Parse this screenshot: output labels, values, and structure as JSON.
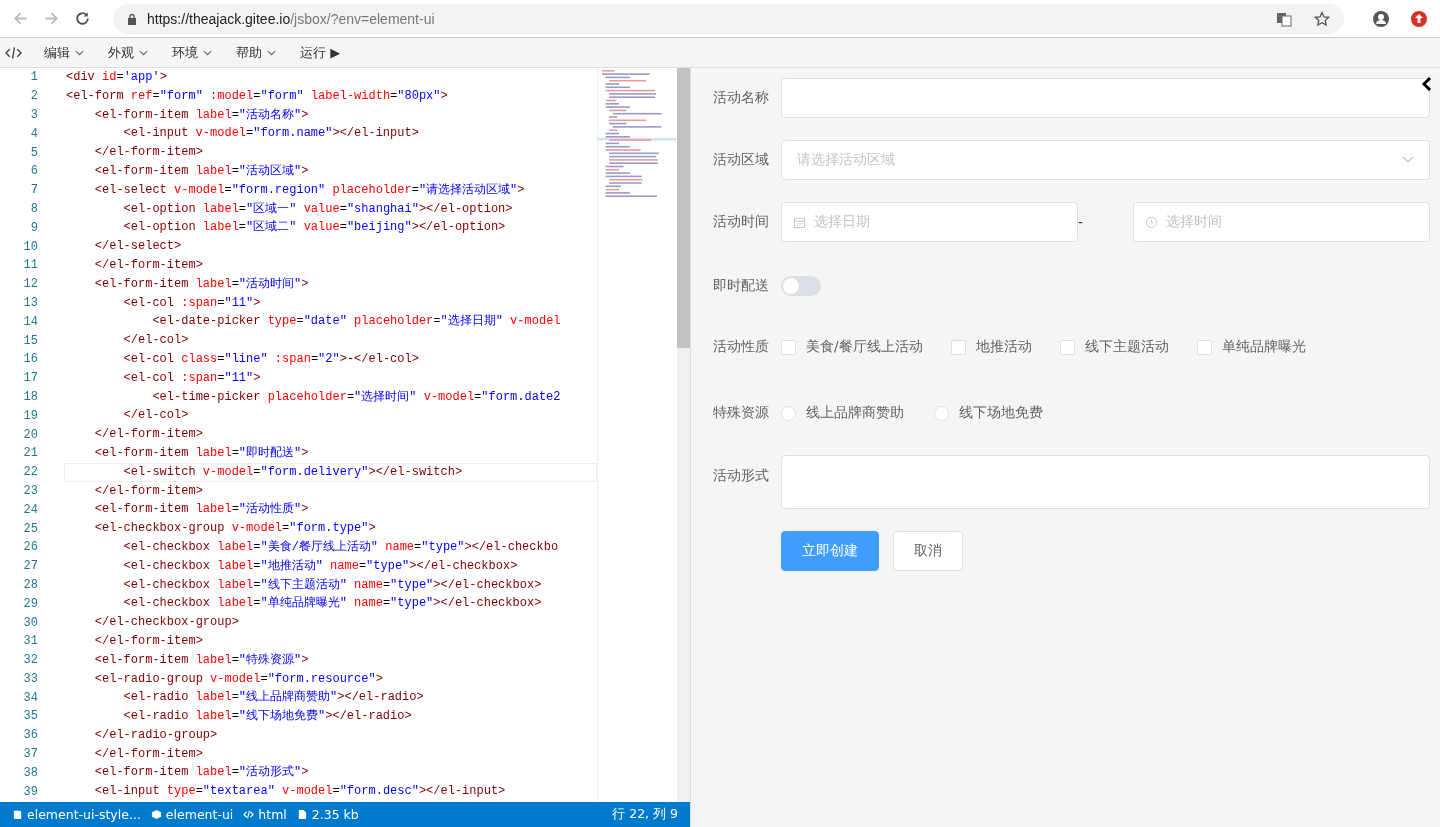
{
  "browser": {
    "url_scheme_host": "https://theajack.gitee.io",
    "url_path": "/jsbox/?env=element-ui"
  },
  "menu": [
    {
      "label": "编辑",
      "kind": "dropdown"
    },
    {
      "label": "外观",
      "kind": "dropdown"
    },
    {
      "label": "环境",
      "kind": "dropdown"
    },
    {
      "label": "帮助",
      "kind": "dropdown"
    },
    {
      "label": "运行",
      "kind": "run",
      "glyph": "▶"
    }
  ],
  "editor": {
    "lines": [
      {
        "n": "1",
        "code": "<div id='app'>",
        "current": false
      },
      {
        "n": "2",
        "code": "<el-form ref=\"form\" :model=\"form\" label-width=\"80px\">",
        "current": false
      },
      {
        "n": "3",
        "code": "    <el-form-item label=\"活动名称\">",
        "current": false
      },
      {
        "n": "4",
        "code": "        <el-input v-model=\"form.name\"></el-input>",
        "current": false
      },
      {
        "n": "5",
        "code": "    </el-form-item>",
        "current": false
      },
      {
        "n": "6",
        "code": "    <el-form-item label=\"活动区域\">",
        "current": false
      },
      {
        "n": "7",
        "code": "    <el-select v-model=\"form.region\" placeholder=\"请选择活动区域\">",
        "current": false
      },
      {
        "n": "8",
        "code": "        <el-option label=\"区域一\" value=\"shanghai\"></el-option>",
        "current": false
      },
      {
        "n": "9",
        "code": "        <el-option label=\"区域二\" value=\"beijing\"></el-option>",
        "current": false
      },
      {
        "n": "10",
        "code": "    </el-select>",
        "current": false
      },
      {
        "n": "11",
        "code": "    </el-form-item>",
        "current": false
      },
      {
        "n": "12",
        "code": "    <el-form-item label=\"活动时间\">",
        "current": false
      },
      {
        "n": "13",
        "code": "        <el-col :span=\"11\">",
        "current": false
      },
      {
        "n": "14",
        "code": "            <el-date-picker type=\"date\" placeholder=\"选择日期\" v-model",
        "current": false
      },
      {
        "n": "15",
        "code": "        </el-col>",
        "current": false
      },
      {
        "n": "16",
        "code": "        <el-col class=\"line\" :span=\"2\">-</el-col>",
        "current": false
      },
      {
        "n": "17",
        "code": "        <el-col :span=\"11\">",
        "current": false
      },
      {
        "n": "18",
        "code": "            <el-time-picker placeholder=\"选择时间\" v-model=\"form.date2",
        "current": false
      },
      {
        "n": "19",
        "code": "        </el-col>",
        "current": false
      },
      {
        "n": "20",
        "code": "    </el-form-item>",
        "current": false
      },
      {
        "n": "21",
        "code": "    <el-form-item label=\"即时配送\">",
        "current": false
      },
      {
        "n": "22",
        "code": "        <el-switch v-model=\"form.delivery\"></el-switch>",
        "current": true
      },
      {
        "n": "23",
        "code": "    </el-form-item>",
        "current": false
      },
      {
        "n": "24",
        "code": "    <el-form-item label=\"活动性质\">",
        "current": false
      },
      {
        "n": "25",
        "code": "    <el-checkbox-group v-model=\"form.type\">",
        "current": false
      },
      {
        "n": "26",
        "code": "        <el-checkbox label=\"美食/餐厅线上活动\" name=\"type\"></el-checkbo",
        "current": false
      },
      {
        "n": "27",
        "code": "        <el-checkbox label=\"地推活动\" name=\"type\"></el-checkbox>",
        "current": false
      },
      {
        "n": "28",
        "code": "        <el-checkbox label=\"线下主题活动\" name=\"type\"></el-checkbox>",
        "current": false
      },
      {
        "n": "29",
        "code": "        <el-checkbox label=\"单纯品牌曝光\" name=\"type\"></el-checkbox>",
        "current": false
      },
      {
        "n": "30",
        "code": "    </el-checkbox-group>",
        "current": false
      },
      {
        "n": "31",
        "code": "    </el-form-item>",
        "current": false
      },
      {
        "n": "32",
        "code": "    <el-form-item label=\"特殊资源\">",
        "current": false
      },
      {
        "n": "33",
        "code": "    <el-radio-group v-model=\"form.resource\">",
        "current": false
      },
      {
        "n": "34",
        "code": "        <el-radio label=\"线上品牌商赞助\"></el-radio>",
        "current": false
      },
      {
        "n": "35",
        "code": "        <el-radio label=\"线下场地免费\"></el-radio>",
        "current": false
      },
      {
        "n": "36",
        "code": "    </el-radio-group>",
        "current": false
      },
      {
        "n": "37",
        "code": "    </el-form-item>",
        "current": false
      },
      {
        "n": "38",
        "code": "    <el-form-item label=\"活动形式\">",
        "current": false
      },
      {
        "n": "39",
        "code": "    <el-input type=\"textarea\" v-model=\"form.desc\"></el-input>",
        "current": false
      }
    ]
  },
  "status_bar": {
    "items": [
      {
        "kind": "book",
        "label": "element-ui-style..."
      },
      {
        "kind": "cube",
        "label": "element-ui"
      },
      {
        "kind": "code",
        "label": "html"
      },
      {
        "kind": "file",
        "label": "2.35 kb"
      }
    ],
    "position": "行 22, 列 9"
  },
  "form": {
    "rows": [
      {
        "kind": "input",
        "label": "活动名称"
      },
      {
        "kind": "select",
        "label": "活动区域",
        "placeholder": "请选择活动区域"
      },
      {
        "kind": "datetime",
        "label": "活动时间",
        "date_placeholder": "选择日期",
        "separator": "-",
        "time_placeholder": "选择时间"
      },
      {
        "kind": "switch",
        "label": "即时配送",
        "on": false
      },
      {
        "kind": "checkboxes",
        "label": "活动性质",
        "options": [
          {
            "label": "美食/餐厅线上活动",
            "checked": false
          },
          {
            "label": "地推活动",
            "checked": false
          },
          {
            "label": "线下主题活动",
            "checked": false
          },
          {
            "label": "单纯品牌曝光",
            "checked": false
          }
        ]
      },
      {
        "kind": "radios",
        "label": "特殊资源",
        "options": [
          {
            "label": "线上品牌商赞助",
            "selected": false
          },
          {
            "label": "线下场地免费",
            "selected": false
          }
        ]
      },
      {
        "kind": "textarea",
        "label": "活动形式"
      }
    ],
    "buttons": [
      {
        "kind": "primary",
        "label": "立即创建"
      },
      {
        "kind": "default",
        "label": "取消"
      }
    ]
  }
}
